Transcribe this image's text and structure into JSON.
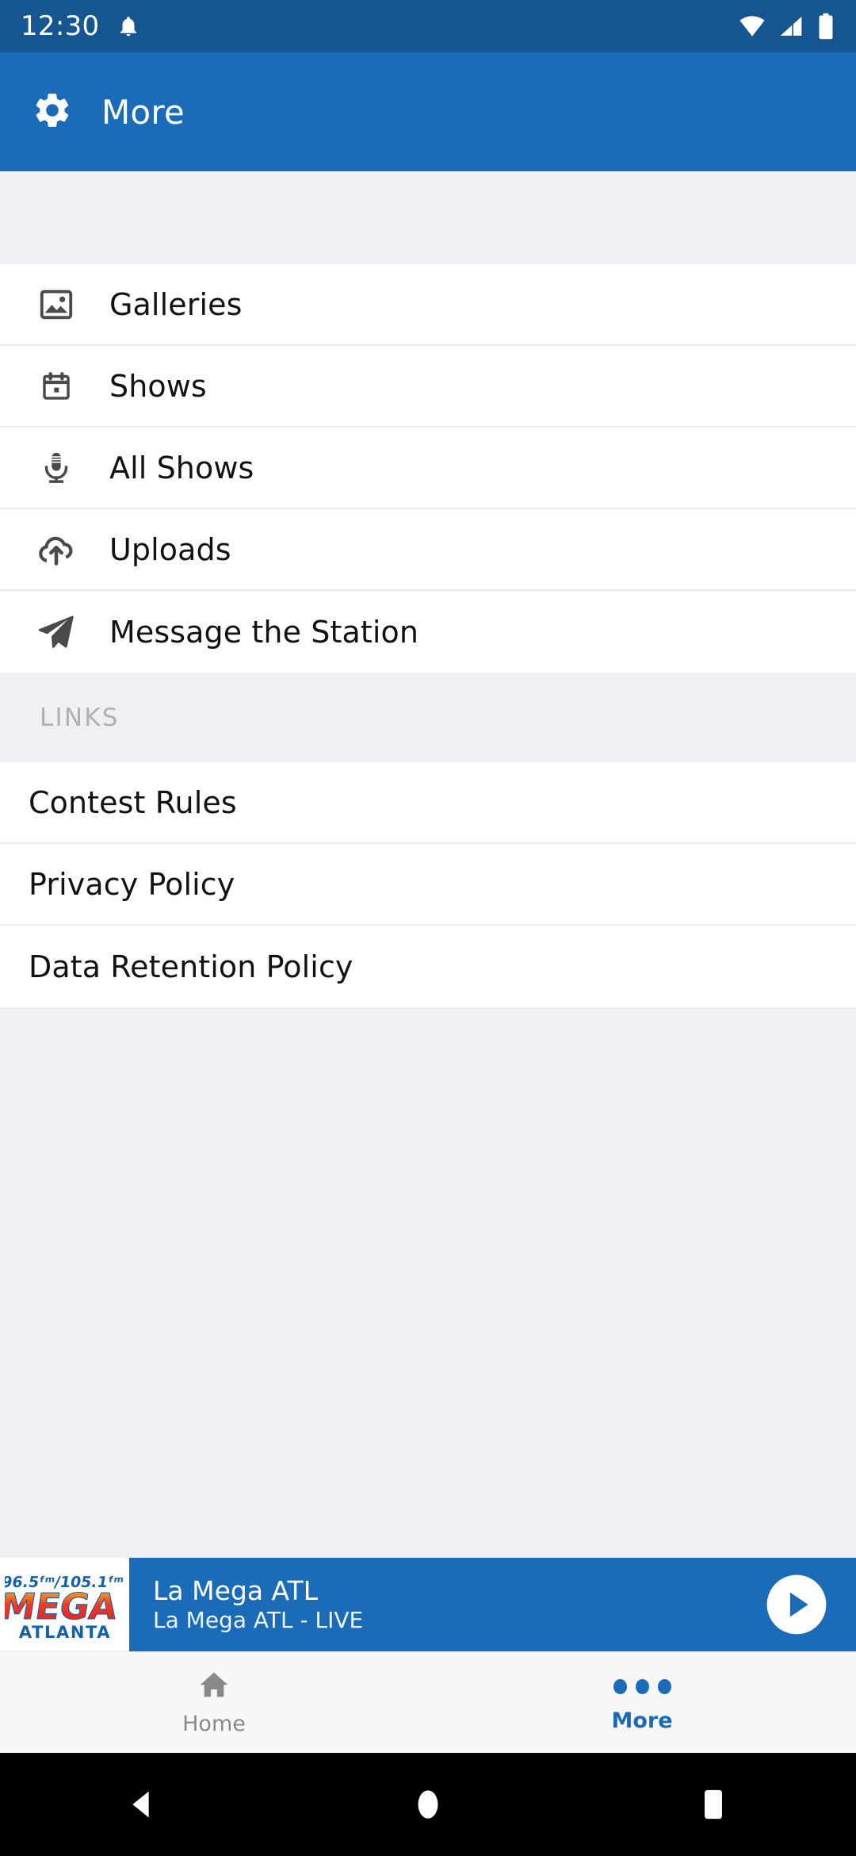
{
  "status_bar": {
    "clock": "12:30",
    "icons": [
      "notification-bell-icon",
      "wifi-icon",
      "cellular-signal-icon",
      "battery-icon"
    ],
    "background": "#155590"
  },
  "app_bar": {
    "icon": "gear-icon",
    "title": "More",
    "background": "#1a6cb8",
    "text_color": "#ffffff"
  },
  "menu": {
    "items": [
      {
        "label": "Galleries",
        "icon": "image-icon"
      },
      {
        "label": "Shows",
        "icon": "calendar-icon"
      },
      {
        "label": "All Shows",
        "icon": "microphone-icon"
      },
      {
        "label": "Uploads",
        "icon": "cloud-upload-icon"
      },
      {
        "label": "Message the Station",
        "icon": "paper-plane-icon"
      }
    ]
  },
  "links_section": {
    "header": "LINKS",
    "items": [
      {
        "label": "Contest Rules"
      },
      {
        "label": "Privacy Policy"
      },
      {
        "label": "Data Retention Policy"
      }
    ]
  },
  "player": {
    "logo": {
      "frequency": "96.5",
      "frequency_unit": "FM",
      "separator": "/",
      "frequency2": "105.1",
      "frequency2_unit": "FM",
      "brand": "MEGA",
      "city": "ATLANTA"
    },
    "title": "La Mega ATL",
    "subtitle": "La Mega ATL - LIVE",
    "button": "play-button",
    "background": "#1a6cb8"
  },
  "bottom_nav": {
    "tabs": [
      {
        "label": "Home",
        "icon": "home-icon",
        "active": false
      },
      {
        "label": "More",
        "icon": "three-dots-icon",
        "active": true
      }
    ],
    "active_color": "#1a6cb8",
    "inactive_color": "#8a8a8a"
  },
  "system_nav": {
    "buttons": [
      "back-button",
      "home-button",
      "recents-button"
    ]
  }
}
